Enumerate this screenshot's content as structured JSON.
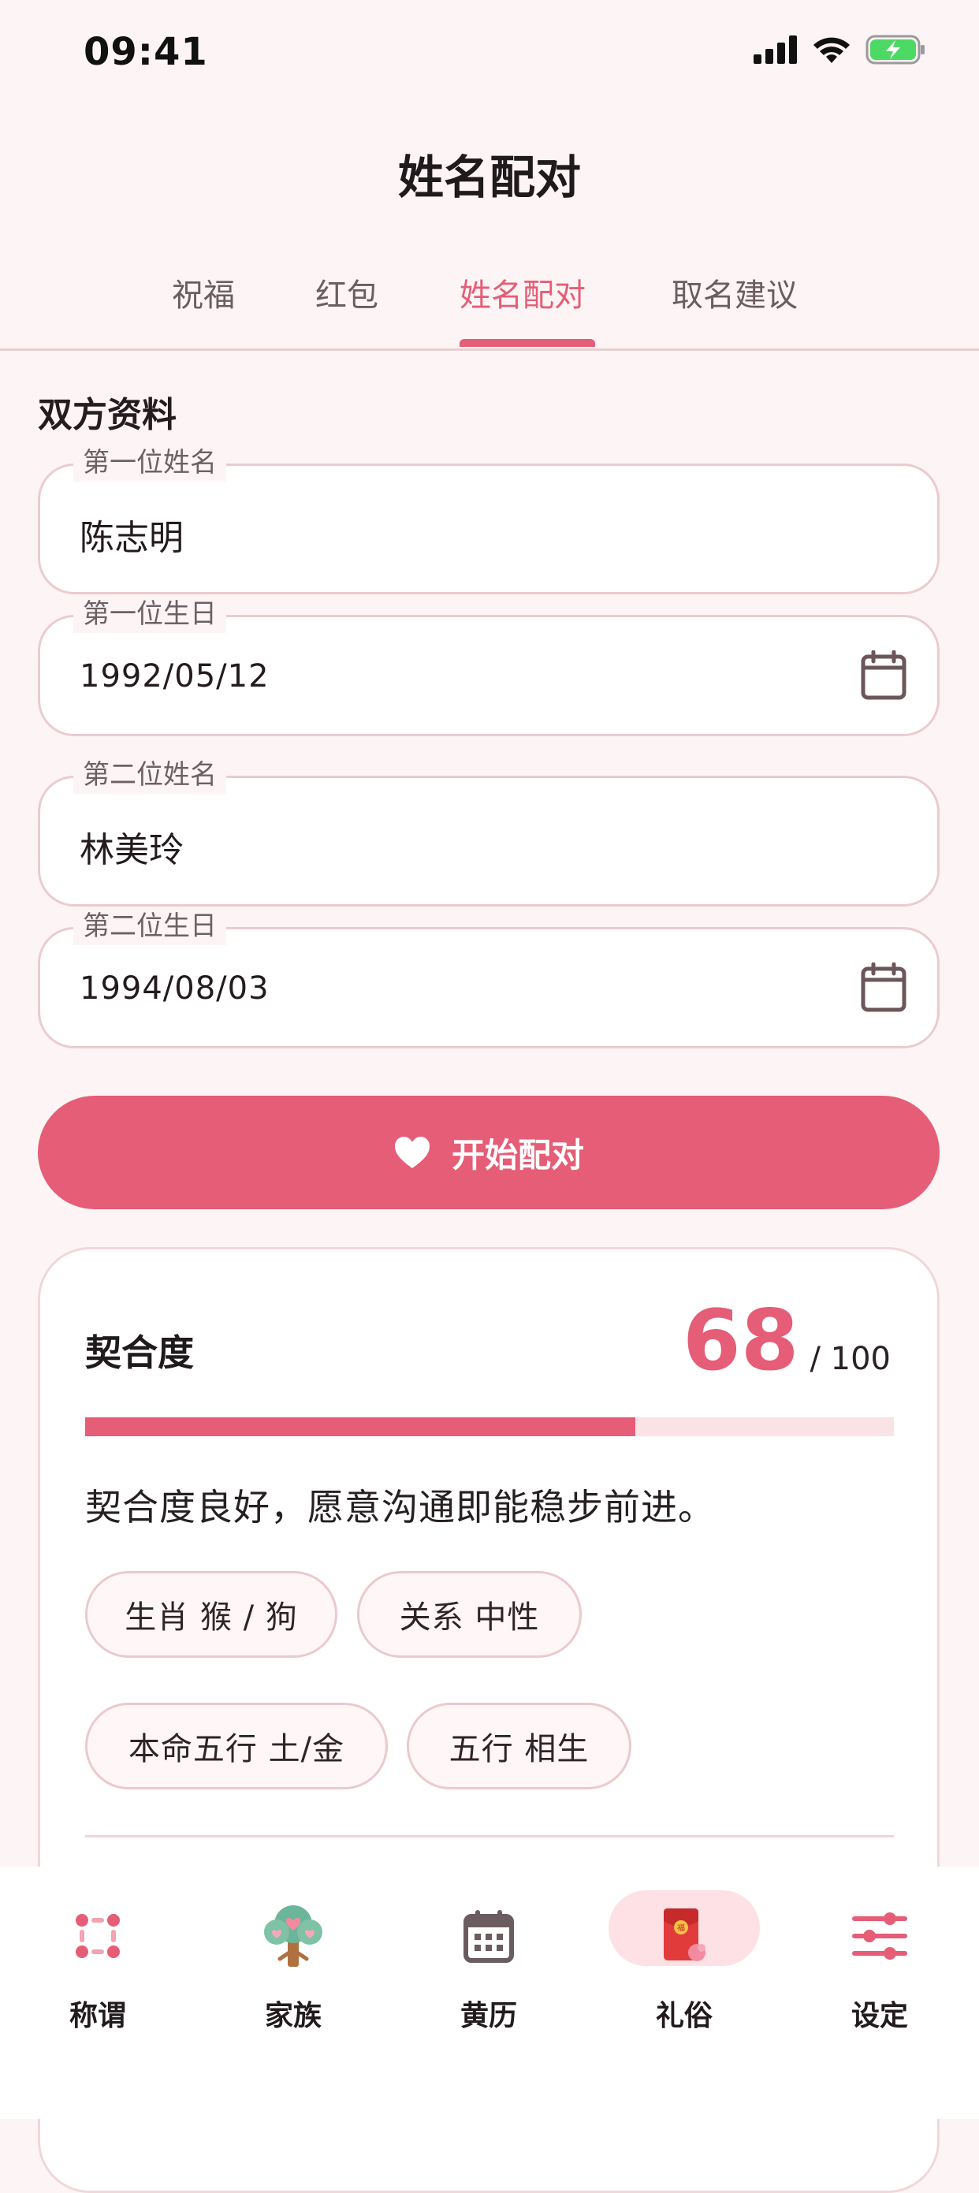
{
  "status_bar": {
    "time": "09:41"
  },
  "header": {
    "title": "姓名配对"
  },
  "tabs": [
    {
      "label": "祝福",
      "active": false
    },
    {
      "label": "红包",
      "active": false
    },
    {
      "label": "姓名配对",
      "active": true
    },
    {
      "label": "取名建议",
      "active": false
    }
  ],
  "form": {
    "section_title": "双方资料",
    "first_name": {
      "label": "第一位姓名",
      "value": "陈志明"
    },
    "first_birthday": {
      "label": "第一位生日",
      "value": "1992/05/12"
    },
    "second_name": {
      "label": "第二位姓名",
      "value": "林美玲"
    },
    "second_birthday": {
      "label": "第二位生日",
      "value": "1994/08/03"
    },
    "submit_label": "开始配对"
  },
  "result": {
    "title": "契合度",
    "score": "68",
    "score_total": "/ 100",
    "progress_fraction": 0.68,
    "description": "契合度良好，愿意沟通即能稳步前进。",
    "chips": [
      {
        "label": "生肖 猴 / 狗"
      },
      {
        "label": "关系 中性"
      },
      {
        "label": "本命五行 土/金"
      },
      {
        "label": "五行 相生"
      }
    ]
  },
  "bottom_nav": [
    {
      "label": "称谓",
      "icon": "kinship-dots-icon",
      "active": false
    },
    {
      "label": "家族",
      "icon": "family-tree-icon",
      "active": false
    },
    {
      "label": "黄历",
      "icon": "calendar-icon",
      "active": false
    },
    {
      "label": "礼俗",
      "icon": "red-envelope-icon",
      "active": true
    },
    {
      "label": "设定",
      "icon": "settings-sliders-icon",
      "active": false
    }
  ],
  "colors": {
    "accent": "#e55d76",
    "background": "#fdf5f5",
    "border": "#ebcbd0",
    "active_pill": "#fde1e5"
  }
}
